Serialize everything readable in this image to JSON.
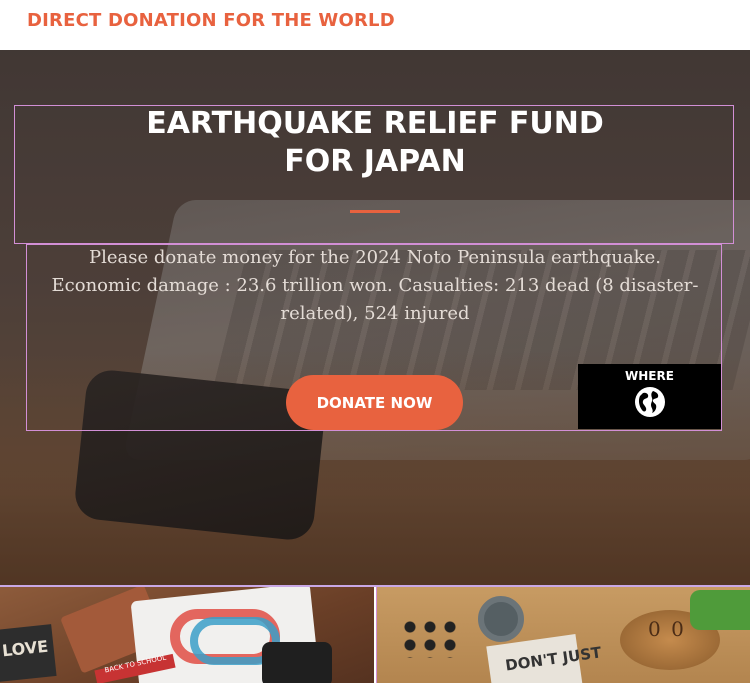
{
  "header": {
    "brand": "DIRECT DONATION FOR THE WORLD"
  },
  "hero": {
    "title_line1": "EARTHQUAKE RELIEF FUND",
    "title_line2": "FOR JAPAN",
    "description": "Please donate money for the 2024 Noto Peninsula earthquake. Economic damage : 23.6 trillion won. Casualties: 213 dead (8 disaster-related), 524 injured",
    "donate_label": "DONATE NOW",
    "where_label": "WHERE",
    "where_icon": "globe-icon"
  },
  "tiles": {
    "left_sign": "LOVE",
    "left_tag": "BACK TO SCHOOL",
    "right_poster": "DON'T JUST",
    "right_dial": "0 0"
  },
  "colors": {
    "accent": "#e8623f",
    "where_bg": "#000000"
  }
}
